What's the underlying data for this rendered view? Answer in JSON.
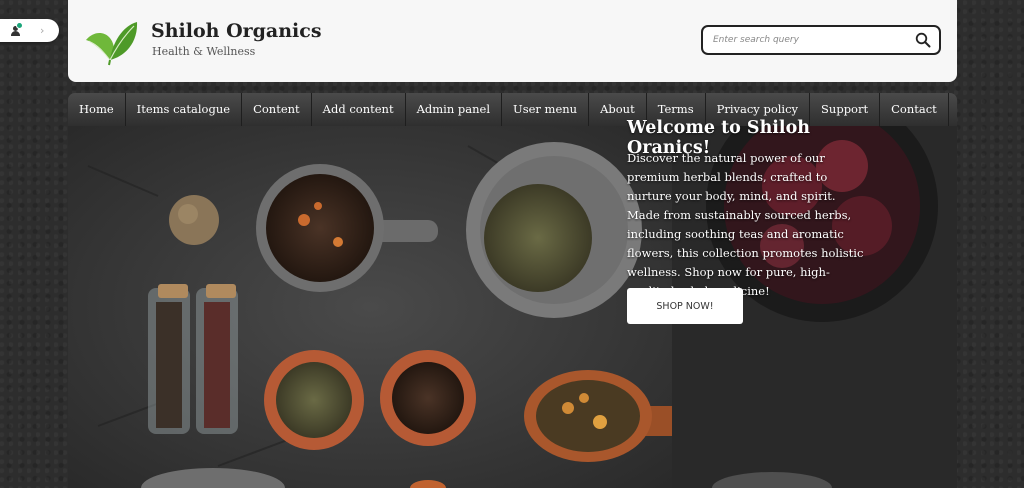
{
  "brand": {
    "name": "Shiloh Organics",
    "tagline": "Health & Wellness"
  },
  "search": {
    "placeholder": "Enter search query"
  },
  "nav": {
    "items": [
      {
        "label": "Home"
      },
      {
        "label": "Items catalogue"
      },
      {
        "label": "Content"
      },
      {
        "label": "Add content"
      },
      {
        "label": "Admin panel"
      },
      {
        "label": "User menu"
      },
      {
        "label": "About"
      },
      {
        "label": "Terms"
      },
      {
        "label": "Privacy policy"
      },
      {
        "label": "Support"
      },
      {
        "label": "Contact"
      }
    ]
  },
  "hero": {
    "title": "Welcome to Shiloh Oranics!",
    "text": "Discover the natural power of our premium herbal blends, crafted to nurture your body, mind, and spirit. Made from sustainably sourced herbs, including soothing teas and aromatic flowers, this collection promotes holistic wellness. Shop now for pure, high-quality herbal medicine!",
    "cta_label": "SHOP NOW!"
  },
  "icons": {
    "user": "user-icon",
    "status": "online-status-icon",
    "widget_toggle": "chevron-right-icon",
    "search": "search-icon",
    "logo": "leaf-logo-icon"
  },
  "colors": {
    "brand_green": "#5a9e2f",
    "status_green": "#1aa57a",
    "nav_bg": "#3b3b3b",
    "header_bg": "#f7f7f7"
  }
}
